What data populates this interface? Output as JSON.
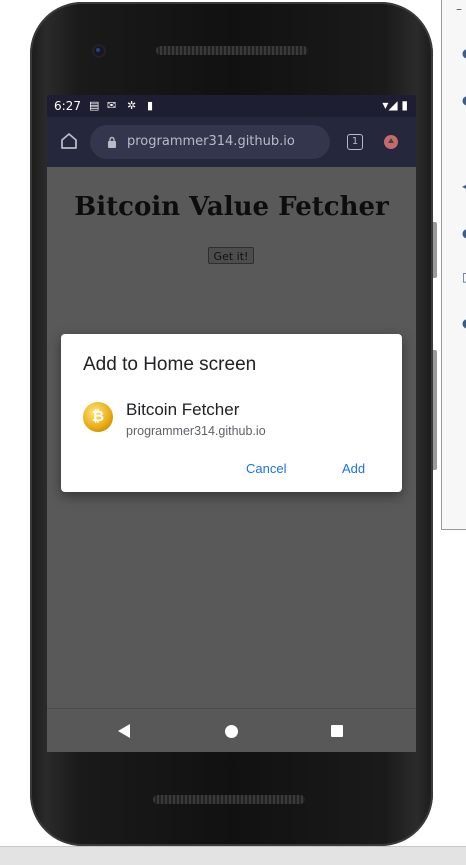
{
  "status_bar": {
    "time": "6:27"
  },
  "browser": {
    "url": "programmer314.github.io",
    "tab_count": "1"
  },
  "page": {
    "title": "Bitcoin Value Fetcher",
    "get_button": "Get it!"
  },
  "dialog": {
    "title": "Add to Home screen",
    "app_name": "Bitcoin Fetcher",
    "app_url": "programmer314.github.io",
    "cancel_label": "Cancel",
    "add_label": "Add",
    "icon_glyph": "₿"
  },
  "side_panel": {
    "collapse": "–"
  },
  "colors": {
    "accent": "#1a73e8",
    "toolbar": "#25273c",
    "status_bar": "#1d1e31"
  }
}
